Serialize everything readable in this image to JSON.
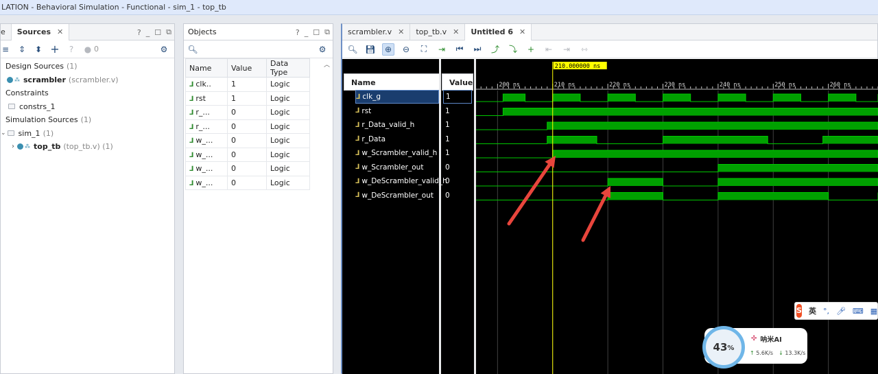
{
  "window": {
    "title": "LATION - Behavioral Simulation - Functional - sim_1 - top_tb"
  },
  "sources": {
    "tab_prev": "e",
    "tab_label": "Sources",
    "badge": "0",
    "tree": [
      {
        "label": "Design Sources",
        "extra": "(1)"
      },
      {
        "label": "scrambler",
        "extra": "(scrambler.v)"
      },
      {
        "label": "Constraints",
        "extra": ""
      },
      {
        "label": "constrs_1",
        "extra": ""
      },
      {
        "label": "Simulation Sources",
        "extra": "(1)"
      },
      {
        "label": "sim_1",
        "extra": "(1)"
      },
      {
        "label": "top_tb",
        "extra": "(top_tb.v) (1)"
      }
    ]
  },
  "objects": {
    "title": "Objects",
    "columns": [
      "Name",
      "Value",
      "Data Type"
    ],
    "rows": [
      {
        "name": "clk..",
        "value": "1",
        "type": "Logic"
      },
      {
        "name": "rst",
        "value": "1",
        "type": "Logic"
      },
      {
        "name": "r_...",
        "value": "0",
        "type": "Logic"
      },
      {
        "name": "r_...",
        "value": "0",
        "type": "Logic"
      },
      {
        "name": "w_...",
        "value": "0",
        "type": "Logic"
      },
      {
        "name": "w_...",
        "value": "0",
        "type": "Logic"
      },
      {
        "name": "w_...",
        "value": "0",
        "type": "Logic"
      },
      {
        "name": "w_...",
        "value": "0",
        "type": "Logic"
      }
    ]
  },
  "editor": {
    "tabs": [
      {
        "label": "scrambler.v"
      },
      {
        "label": "top_tb.v"
      },
      {
        "label": "Untitled 6"
      }
    ]
  },
  "wave": {
    "name_header": "Name",
    "value_header": "Value",
    "cursor_label": "210.000000 ns",
    "cursor_time": 210,
    "time_start": 196.1,
    "time_end": 269.0,
    "ticks": [
      {
        "t": 200,
        "label": "200 ns"
      },
      {
        "t": 210,
        "label": "210 ns"
      },
      {
        "t": 220,
        "label": "220 ns"
      },
      {
        "t": 230,
        "label": "230 ns"
      },
      {
        "t": 240,
        "label": "240 ns"
      },
      {
        "t": 250,
        "label": "250 ns"
      },
      {
        "t": 260,
        "label": "260 ns"
      }
    ],
    "signals": [
      {
        "name": "clk_g",
        "value": "1",
        "init": 0,
        "changes": [
          201,
          205,
          210,
          215,
          220,
          225,
          230,
          235,
          240,
          245,
          250,
          255,
          260,
          265
        ]
      },
      {
        "name": "rst",
        "value": "1",
        "init": 0,
        "changes": [
          201
        ]
      },
      {
        "name": "r_Data_valid_h",
        "value": "1",
        "init": 0,
        "changes": [
          209
        ]
      },
      {
        "name": "r_Data",
        "value": "1",
        "init": 0,
        "changes": [
          209,
          218,
          230,
          249,
          259
        ]
      },
      {
        "name": "w_Scrambler_valid_h",
        "value": "1",
        "init": 0,
        "changes": [
          210
        ]
      },
      {
        "name": "w_Scrambler_out",
        "value": "0",
        "init": 0,
        "changes": [
          240
        ]
      },
      {
        "name": "w_DeScrambler_valid_h",
        "value": "0",
        "init": 0,
        "changes": [
          220,
          230,
          240
        ]
      },
      {
        "name": "w_DeScrambler_out",
        "value": "0",
        "init": 0,
        "changes": [
          220,
          230,
          240,
          260
        ]
      }
    ]
  },
  "widget": {
    "percent": "43",
    "percent_unit": "%",
    "app_name": "呐米AI",
    "up": "5.6K/s",
    "down": "13.3K/s"
  },
  "ime": {
    "lang": "英"
  },
  "colors": {
    "wave_fill": "#00a000",
    "wave_line": "#00c800",
    "cursor": "#ffff00",
    "arrow": "#e8453c",
    "grid": "#404040"
  }
}
